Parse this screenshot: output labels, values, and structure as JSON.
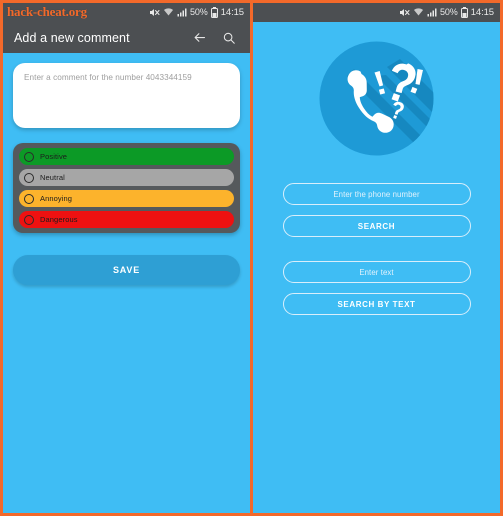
{
  "meta": {
    "watermark": "hack-cheat.org"
  },
  "status_bar": {
    "mute_icon": "mute-icon",
    "wifi_icon": "wifi-icon",
    "signal_icon": "signal-icon",
    "battery_percent": "50%",
    "battery_icon": "battery-icon",
    "time": "14:15"
  },
  "left_panel": {
    "title_bar": {
      "title": "Add a new comment",
      "back_icon": "back-arrow-icon",
      "search_icon": "search-icon"
    },
    "comment_input": {
      "placeholder": "Enter a comment for the number 4043344159",
      "value": ""
    },
    "options": [
      {
        "label": "Positive",
        "color": "#0c9a26",
        "selected": false
      },
      {
        "label": "Neutral",
        "color": "#a6a6a6",
        "selected": false
      },
      {
        "label": "Annoying",
        "color": "#fcb32c",
        "selected": false
      },
      {
        "label": "Dangerous",
        "color": "#ee1111",
        "selected": false
      }
    ],
    "save_label": "SAVE"
  },
  "right_panel": {
    "logo": {
      "name": "phone-question-logo",
      "circle_color": "#1e9ad6",
      "glyph_color": "#ffffff"
    },
    "phone_input_placeholder": "Enter the phone number",
    "search_label": "SEARCH",
    "text_input_placeholder": "Enter text",
    "search_by_text_label": "SEARCH BY TEXT"
  },
  "colors": {
    "app_background": "#3fbdf4",
    "bar_background": "#4c4f52",
    "accent_orange": "#f3692a",
    "save_button": "#2e9fd4",
    "options_card": "#55595c"
  }
}
